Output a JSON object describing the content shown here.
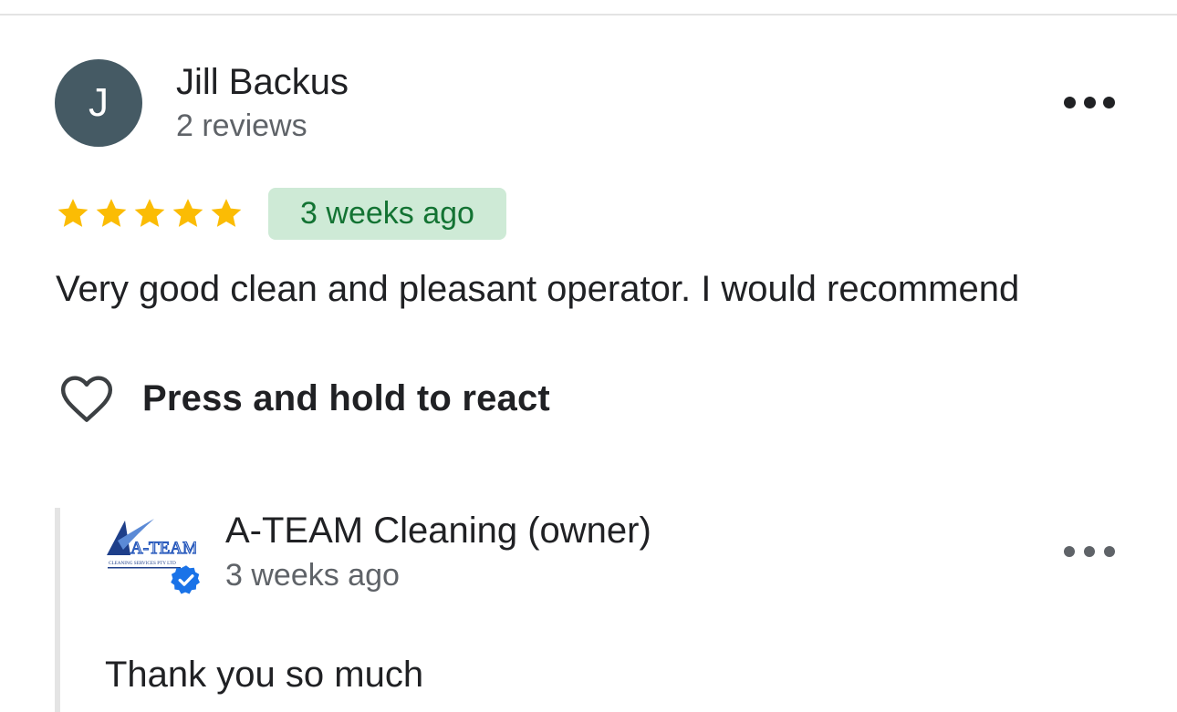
{
  "review": {
    "avatar_initial": "J",
    "reviewer_name": "Jill Backus",
    "reviewer_meta": "2 reviews",
    "rating": 5,
    "rating_max": 5,
    "time_ago": "3 weeks ago",
    "text": "Very good clean and pleasant operator. I would recommend",
    "react_label": "Press and hold to react"
  },
  "owner_reply": {
    "logo_text": "A-TEAM",
    "logo_subtext": "CLEANING SERVICES PTY LTD",
    "owner_name": "A-TEAM Cleaning (owner)",
    "time_ago": "3 weeks ago",
    "text": "Thank you so much"
  },
  "colors": {
    "avatar_bg": "#455a64",
    "star": "#fbbc04",
    "badge_bg": "#ceead6",
    "badge_text": "#137333",
    "verified": "#1a73e8"
  }
}
